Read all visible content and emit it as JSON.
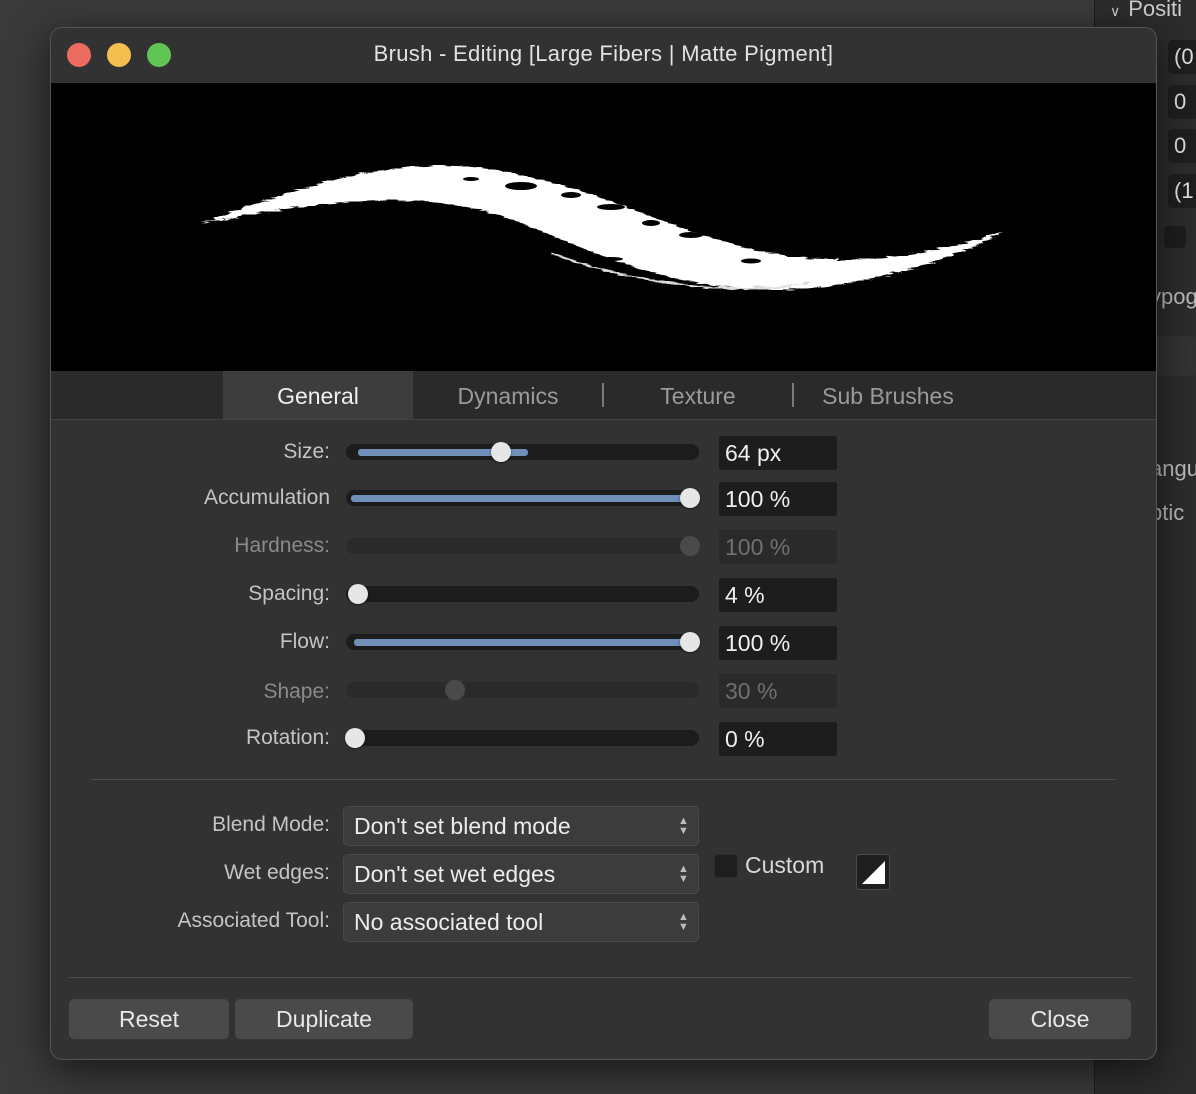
{
  "background_panel": {
    "heading": "Positi",
    "fields": [
      "(0",
      "0",
      "0",
      "(1"
    ],
    "text_rows": [
      "ypog",
      "angu",
      "ptic"
    ]
  },
  "dialog": {
    "title": "Brush - Editing [Large Fibers | Matte Pigment]",
    "tabs": [
      {
        "label": "General",
        "active": true
      },
      {
        "label": "Dynamics",
        "active": false
      },
      {
        "label": "Texture",
        "active": false
      },
      {
        "label": "Sub Brushes",
        "active": false
      }
    ],
    "sliders": [
      {
        "label": "Size:",
        "value": "64 px",
        "level": 0.45,
        "enabled": true
      },
      {
        "label": "Accumulation",
        "value": "100 %",
        "level": 1.0,
        "enabled": true
      },
      {
        "label": "Hardness:",
        "value": "100 %",
        "level": 1.0,
        "enabled": false
      },
      {
        "label": "Spacing:",
        "value": "4 %",
        "level": 0.04,
        "enabled": true
      },
      {
        "label": "Flow:",
        "value": "100 %",
        "level": 1.0,
        "enabled": true
      },
      {
        "label": "Shape:",
        "value": "30 %",
        "level": 0.3,
        "enabled": false
      },
      {
        "label": "Rotation:",
        "value": "0 %",
        "level": 0.0,
        "enabled": true
      }
    ],
    "selects": [
      {
        "label": "Blend Mode:",
        "value": "Don't set blend mode"
      },
      {
        "label": "Wet edges:",
        "value": "Don't set wet edges"
      },
      {
        "label": "Associated Tool:",
        "value": "No associated tool"
      }
    ],
    "custom_label": "Custom",
    "custom_checked": false,
    "buttons": {
      "reset": "Reset",
      "duplicate": "Duplicate",
      "close": "Close"
    },
    "colors": {
      "accent": "#6f8fb8",
      "close_light": "#ed6a5e",
      "min_light": "#f5bf4f",
      "max_light": "#61c554"
    }
  }
}
